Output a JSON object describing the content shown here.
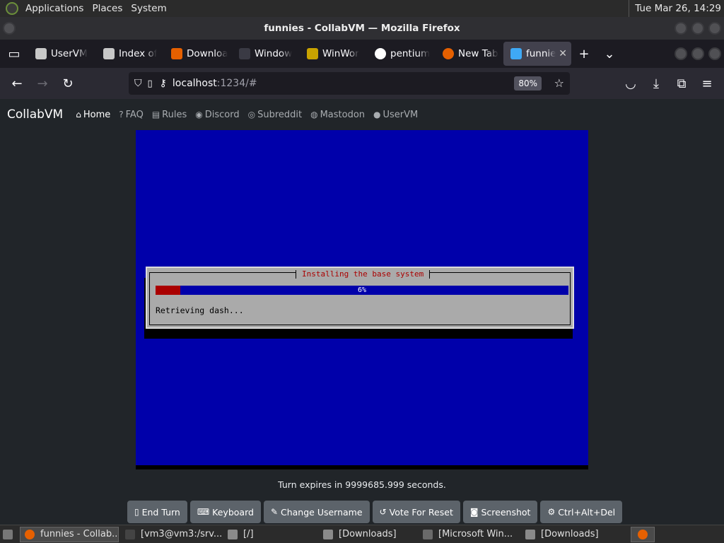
{
  "top_panel": {
    "menus": [
      "Applications",
      "Places",
      "System"
    ],
    "clock": "Tue Mar 26, 14:29"
  },
  "window": {
    "title": "funnies - CollabVM — Mozilla Firefox"
  },
  "tabs": [
    {
      "label": "UserVM",
      "icon": "collabvm-icon"
    },
    {
      "label": "Index of",
      "icon": "collabvm-icon"
    },
    {
      "label": "Downloa",
      "icon": "firefox-download-icon"
    },
    {
      "label": "Window",
      "icon": "heart-icon"
    },
    {
      "label": "WinWor",
      "icon": "winworld-icon"
    },
    {
      "label": "pentium",
      "icon": "google-icon"
    },
    {
      "label": "New Tab",
      "icon": "firefox-icon"
    },
    {
      "label": "funnie",
      "icon": "monitor-icon",
      "active": true
    }
  ],
  "navbar": {
    "url_host": "localhost",
    "url_path": ":1234/#",
    "zoom": "80%"
  },
  "site_nav": {
    "brand": "CollabVM",
    "items": [
      {
        "label": "Home",
        "icon": "home-icon",
        "glyph": "⌂",
        "active": true
      },
      {
        "label": "FAQ",
        "icon": "question-icon",
        "glyph": "?"
      },
      {
        "label": "Rules",
        "icon": "clipboard-icon",
        "glyph": "▤"
      },
      {
        "label": "Discord",
        "icon": "discord-icon",
        "glyph": "◉"
      },
      {
        "label": "Subreddit",
        "icon": "reddit-icon",
        "glyph": "◎"
      },
      {
        "label": "Mastodon",
        "icon": "mastodon-icon",
        "glyph": "◍"
      },
      {
        "label": "UserVM",
        "icon": "person-icon",
        "glyph": "●"
      }
    ]
  },
  "vm": {
    "dialog_title": "Installing the base system",
    "progress_fraction": 0.06,
    "progress_text": "6%",
    "status_text": "Retrieving dash..."
  },
  "turn_text": "Turn expires in 9999685.999 seconds.",
  "vm_buttons": [
    {
      "label": "End Turn",
      "icon": "door-icon",
      "glyph": "▯"
    },
    {
      "label": "Keyboard",
      "icon": "keyboard-icon",
      "glyph": "⌨"
    },
    {
      "label": "Change Username",
      "icon": "signature-icon",
      "glyph": "✎"
    },
    {
      "label": "Vote For Reset",
      "icon": "reset-icon",
      "glyph": "↺"
    },
    {
      "label": "Screenshot",
      "icon": "camera-icon",
      "glyph": "◙"
    },
    {
      "label": "Ctrl+Alt+Del",
      "icon": "gear-icon",
      "glyph": "⚙"
    }
  ],
  "taskbar": [
    {
      "label": "funnies - Collab...",
      "icon": "firefox-icon",
      "active": true
    },
    {
      "label": "[vm3@vm3:/srv...",
      "icon": "terminal-icon"
    },
    {
      "label": "[/]",
      "icon": "folder-icon"
    },
    {
      "label": "[Downloads]",
      "icon": "folder-icon"
    },
    {
      "label": "[Microsoft Win...",
      "icon": "window-icon"
    },
    {
      "label": "[Downloads]",
      "icon": "folder-icon"
    }
  ],
  "colors": {
    "vm_blue": "#0000aa",
    "progress_red": "#aa0000",
    "dialog_gray": "#aaaaaa",
    "page_bg": "#212529",
    "button_gray": "#5c636a"
  }
}
